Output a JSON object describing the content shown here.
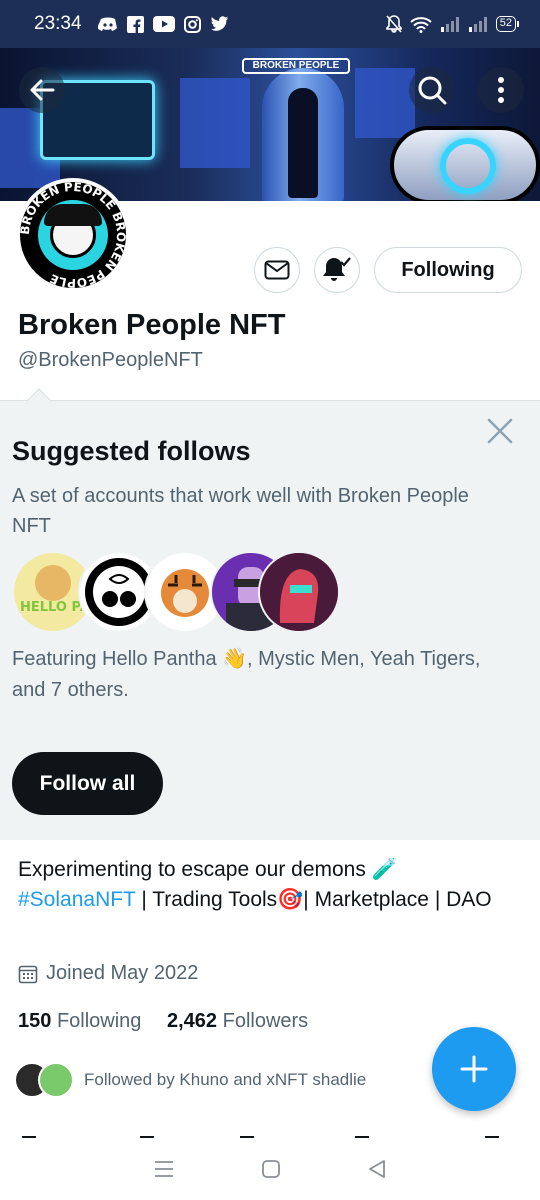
{
  "status_bar": {
    "time": "23:34",
    "battery": "52",
    "icons": [
      "discord-icon",
      "facebook-icon",
      "youtube-icon",
      "instagram-icon",
      "twitter-icon"
    ],
    "right_icons": [
      "mute-icon",
      "wifi-icon",
      "signal-icon",
      "signal-icon"
    ]
  },
  "banner": {
    "sign_text": "BROKEN PEOPLE"
  },
  "avatar": {
    "ring_text": "BROKEN PEOPLE BROKEN PEOPLE"
  },
  "profile": {
    "following_button": "Following",
    "name": "Broken People NFT",
    "handle": "@BrokenPeopleNFT"
  },
  "suggested": {
    "title": "Suggested follows",
    "description": "A set of accounts that work well with Broken People NFT",
    "featuring": "Featuring Hello Pantha 👋, Mystic Men, Yeah Tigers, and 7 others.",
    "follow_all": "Follow all",
    "avatar_1_text": "HELLO PANTHA"
  },
  "bio": {
    "line1": "Experimenting to escape our demons 🧪",
    "hashtag": "#SolanaNFT",
    "rest": " | Trading Tools🎯| Marketplace | DAO"
  },
  "joined": "Joined May 2022",
  "stats": {
    "following_count": "150",
    "following_label": "Following",
    "followers_count": "2,462",
    "followers_label": "Followers"
  },
  "followed_by": "Followed by Khuno and xNFT shadlie",
  "colors": {
    "accent": "#1d9bf0",
    "status_bar": "#1d2f57",
    "suggest_bg": "#eff3f4"
  }
}
